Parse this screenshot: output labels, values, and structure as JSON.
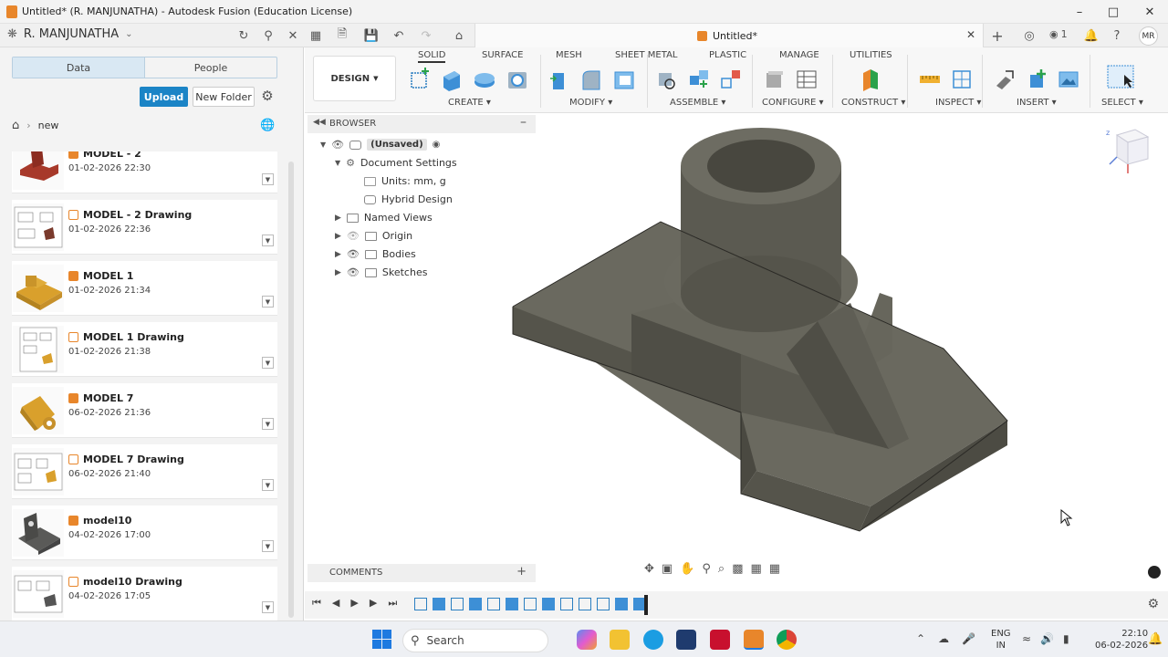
{
  "window": {
    "title": "Untitled* (R. MANJUNATHA) - Autodesk Fusion (Education License)"
  },
  "header": {
    "user": "R. MANJUNATHA",
    "doc_tab": "Untitled*",
    "job_count": "1",
    "avatar": "MR"
  },
  "data_panel": {
    "tabs": [
      "Data",
      "People"
    ],
    "upload_label": "Upload",
    "new_folder_label": "New Folder",
    "breadcrumb": "new",
    "files": [
      {
        "name": "MODEL - 2",
        "date": "01-02-2026 22:30",
        "kind": "model"
      },
      {
        "name": "MODEL - 2 Drawing",
        "date": "01-02-2026 22:36",
        "kind": "drawing"
      },
      {
        "name": "MODEL 1",
        "date": "01-02-2026 21:34",
        "kind": "model"
      },
      {
        "name": "MODEL 1 Drawing",
        "date": "01-02-2026 21:38",
        "kind": "drawing"
      },
      {
        "name": "MODEL 7",
        "date": "06-02-2026 21:36",
        "kind": "model"
      },
      {
        "name": "MODEL 7 Drawing",
        "date": "06-02-2026 21:40",
        "kind": "drawing"
      },
      {
        "name": "model10",
        "date": "04-02-2026 17:00",
        "kind": "model"
      },
      {
        "name": "model10 Drawing",
        "date": "04-02-2026 17:05",
        "kind": "drawing"
      }
    ]
  },
  "toolbar": {
    "workspace": "DESIGN",
    "tabs": [
      "SOLID",
      "SURFACE",
      "MESH",
      "SHEET METAL",
      "PLASTIC",
      "MANAGE",
      "UTILITIES"
    ],
    "active_tab": "SOLID",
    "groups": [
      "CREATE",
      "MODIFY",
      "ASSEMBLE",
      "CONFIGURE",
      "CONSTRUCT",
      "INSPECT",
      "INSERT",
      "SELECT"
    ]
  },
  "browser": {
    "title": "BROWSER",
    "root": "(Unsaved)",
    "items": [
      "Document Settings",
      "Units: mm, g",
      "Hybrid Design",
      "Named Views",
      "Origin",
      "Bodies",
      "Sketches"
    ]
  },
  "comments": {
    "title": "COMMENTS"
  },
  "taskbar": {
    "search_placeholder": "Search",
    "lang1": "ENG",
    "lang2": "IN",
    "time": "22:10",
    "date": "06-02-2026"
  },
  "colors": {
    "accent": "#1b84c6",
    "brand_orange": "#e8862b",
    "model_body": "#5f5e55"
  }
}
